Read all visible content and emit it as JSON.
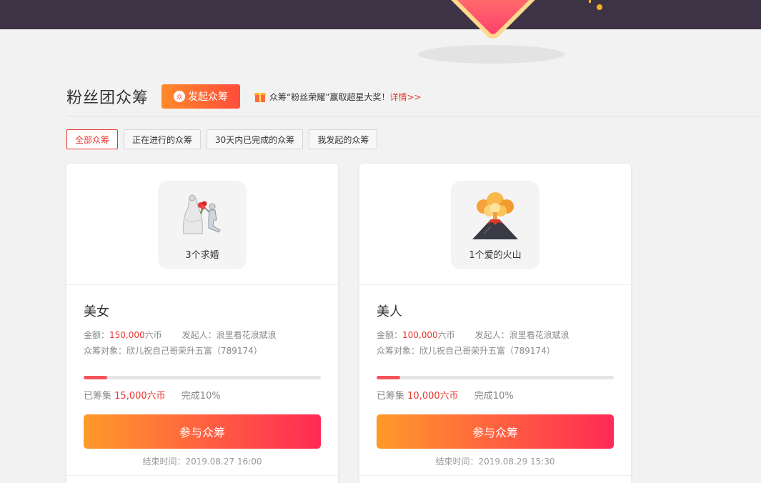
{
  "header": {
    "title": "粉丝团众筹",
    "launch_button": "发起众筹",
    "launch_icon": "众",
    "promo_text": "众筹“粉丝荣耀”赢取超星大奖！",
    "promo_link": "详情>>"
  },
  "filters": [
    "全部众筹",
    "正在进行的众筹",
    "30天内已完成的众筹",
    "我发起的众筹"
  ],
  "active_filter": 0,
  "cards": [
    {
      "gift_label": "3个求婚",
      "gift_icon": "proposal-icon",
      "name": "美女",
      "amount_label": "金额：",
      "amount": "150,000",
      "amount_unit": "六币",
      "initiator_label": "发起人：",
      "initiator": "浪里看花浪斌浪",
      "target_label": "众筹对象：",
      "target": "欣儿祝自己哥荣升五富（789174）",
      "progress": 0.1,
      "raised_label": "已筹集",
      "raised": "15,000六币",
      "complete": "完成10%",
      "join_button": "参与众筹",
      "end_time": "结束时间：2019.08.27 16:00"
    },
    {
      "gift_label": "1个爱的火山",
      "gift_icon": "volcano-icon",
      "name": "美人",
      "amount_label": "金额：",
      "amount": "100,000",
      "amount_unit": "六币",
      "initiator_label": "发起人：",
      "initiator": "浪里看花浪斌浪",
      "target_label": "众筹对象：",
      "target": "欣儿祝自己哥荣升五富（789174）",
      "progress": 0.1,
      "raised_label": "已筹集",
      "raised": "10,000六币",
      "complete": "完成10%",
      "join_button": "参与众筹",
      "end_time": "结束时间：2019.08.29 15:30"
    }
  ],
  "colors": {
    "accent": "#e6372f",
    "button_gradient_start": "#ff9a2a",
    "button_gradient_end": "#ff2a55",
    "topbar": "#3e3344"
  }
}
